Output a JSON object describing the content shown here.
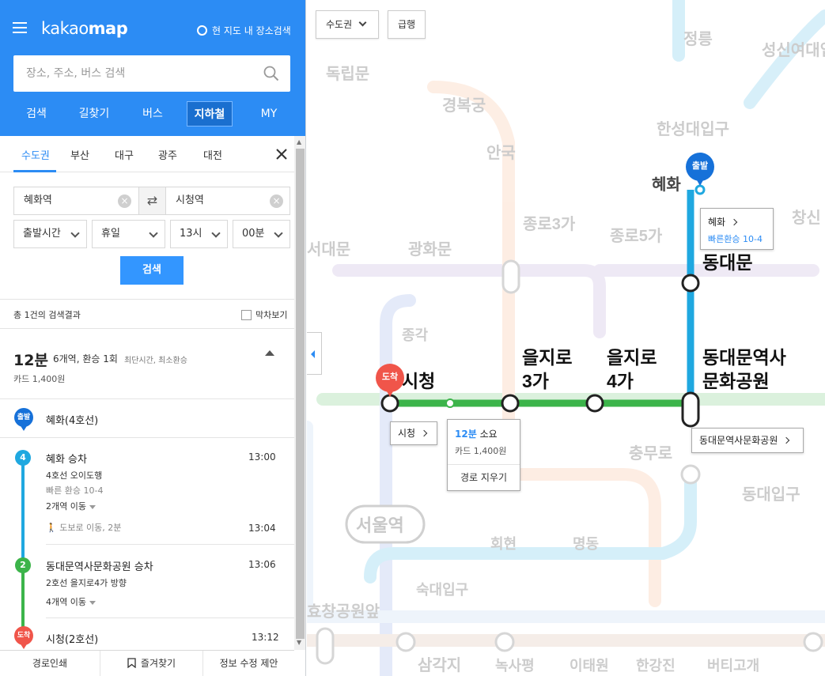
{
  "header": {
    "logo_light": "kakao",
    "logo_bold": "map",
    "map_search_label": "현 지도 내 장소검색",
    "search_placeholder": "장소, 주소, 버스 검색",
    "tabs": [
      "검색",
      "길찾기",
      "버스",
      "지하철",
      "MY"
    ],
    "active_tab": "지하철",
    "brand_color": "#2c8cf4"
  },
  "regions": {
    "tabs": [
      "수도권",
      "부산",
      "대구",
      "광주",
      "대전"
    ],
    "active": "수도권"
  },
  "route": {
    "from": "혜화역",
    "to": "시청역",
    "options": {
      "time_type": "출발시간",
      "day": "휴일",
      "hour": "13시",
      "minute": "00분"
    },
    "search_button": "검색"
  },
  "results": {
    "count_text": "총 1건의 검색결과",
    "last_train_label": "막차보기",
    "summary": {
      "time": "12분",
      "detail": "6개역, 환승 1회",
      "tags": "최단시간, 최소환승",
      "fare": "카드 1,400원"
    },
    "start": {
      "badge": "출발",
      "station": "혜화(4호선)"
    },
    "legs": [
      {
        "line_badge": "4",
        "line_color": "#1fa8e0",
        "board": "혜화 승차",
        "time": "13:00",
        "direction": "4호선 오이도행",
        "transfer": "빠른 환승 10-4",
        "stops": "2개역 이동",
        "walk": "도보로 이동, 2분",
        "walk_end_time": "13:04"
      },
      {
        "line_badge": "2",
        "line_color": "#3cb44a",
        "board": "동대문역사문화공원 승차",
        "time": "13:06",
        "direction": "2호선 을지로4가 방향",
        "stops": "4개역 이동"
      }
    ],
    "end": {
      "badge": "도착",
      "station": "시청(2호선)",
      "time": "13:12"
    }
  },
  "footer": {
    "print": "경로인쇄",
    "bookmark": "즐겨찾기",
    "report": "정보 수정 제안"
  },
  "map": {
    "region_select": "수도권",
    "express_button": "급행",
    "stations_bg": [
      "독립문",
      "경복궁",
      "안국",
      "정릉",
      "성신여대입구",
      "한성대입구",
      "창신",
      "서대문",
      "광화문",
      "종각",
      "종로3가",
      "종로5가",
      "충무로",
      "회현",
      "명동",
      "동대입구",
      "서울역",
      "숙대입구",
      "효창공원앞",
      "삼각지",
      "녹사평",
      "이태원",
      "한강진",
      "버티고개"
    ],
    "route_stations": {
      "hyehwa": "혜화",
      "dongdaemun": "동대문",
      "ddp_line1": "동대문역사",
      "ddp_line2": "문화공원",
      "euljiro3_1": "을지로",
      "euljiro3_2": "3가",
      "euljiro4_1": "을지로",
      "euljiro4_2": "4가",
      "cityhall": "시청"
    },
    "start_marker": "출발",
    "end_marker": "도착",
    "callouts": {
      "hyehwa_title": "혜화",
      "hyehwa_sub": "빠른환승 10-4",
      "ddp": "동대문역사문화공원",
      "cityhall": "시청"
    },
    "popup": {
      "time": "12분",
      "time_suffix": "소요",
      "fare": "카드 1,400원",
      "clear": "경로 지우기"
    },
    "colors": {
      "line2": "#3cb44a",
      "line4": "#1fa8e0",
      "start_pin": "#1671d9",
      "end_pin": "#f0554a"
    }
  }
}
